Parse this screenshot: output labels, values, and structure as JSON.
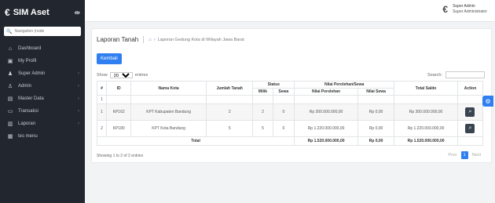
{
  "sidebar": {
    "brand": "SIM Aset",
    "search_placeholder": "Navigation (node",
    "items": [
      {
        "label": "Dashboard",
        "icon": "home-icon",
        "has_children": false
      },
      {
        "label": "My Profil",
        "icon": "id-card-icon",
        "has_children": false
      },
      {
        "label": "Super Admin",
        "icon": "users-icon",
        "has_children": true
      },
      {
        "label": "Admin",
        "icon": "user-icon",
        "has_children": true
      },
      {
        "label": "Master Data",
        "icon": "database-icon",
        "has_children": true
      },
      {
        "label": "Transaksi",
        "icon": "transaction-icon",
        "has_children": true
      },
      {
        "label": "Laporan",
        "icon": "report-icon",
        "has_children": true
      },
      {
        "label": "tes menu",
        "icon": "file-icon",
        "has_children": false
      }
    ]
  },
  "topbar": {
    "user_name": "Super Admin",
    "user_role": "Super Administrator"
  },
  "page": {
    "title": "Laporan Tanah",
    "breadcrumb": "Laporan Gedung Kota di Wilayah Jawa Barat",
    "back_button": "Kembali"
  },
  "table_controls": {
    "show_label": "Show",
    "entries_value": "20",
    "entries_label": "entries",
    "search_label": "Search:"
  },
  "table": {
    "headers": {
      "no": "#",
      "id": "ID",
      "kota": "Nama Kota",
      "jumlah": "Jumlah Tanah",
      "status": "Status",
      "milik": "Milik",
      "sewa": "Sewa",
      "nilai_group": "Nilai Perolehan/Sewa",
      "nilai_perolehan": "Nilai Perolehan",
      "nilai_sewa": "Nilai Sewa",
      "total_saldo": "Total Saldo",
      "action": "Action"
    },
    "filter_first": "1",
    "rows": [
      {
        "no": "1",
        "id": "KP162",
        "kota": "KPT Kabupaten Bandung",
        "jumlah": "2",
        "milik": "2",
        "sewa": "0",
        "nilai_perolehan": "Rp 300.000.000,00",
        "nilai_sewa": "Rp 0,00",
        "total_saldo": "Rp 300.000.000,00"
      },
      {
        "no": "2",
        "id": "KP180",
        "kota": "KPT Kota Bandung",
        "jumlah": "5",
        "milik": "5",
        "sewa": "0",
        "nilai_perolehan": "Rp 1.220.000.000,00",
        "nilai_sewa": "Rp 0,00",
        "total_saldo": "Rp 1.220.000.000,00"
      }
    ],
    "total": {
      "label": "Total",
      "nilai_perolehan": "Rp 1.520.000.000,00",
      "nilai_sewa": "Rp 0,00",
      "total_saldo": "Rp 1.520.000.000,00"
    }
  },
  "footer": {
    "info": "Showing 1 to 2 of 2 entries",
    "prev": "Prev",
    "page": "1",
    "next": "Next"
  },
  "colors": {
    "sidebar_bg": "#22262e",
    "accent": "#2f7ff0"
  }
}
